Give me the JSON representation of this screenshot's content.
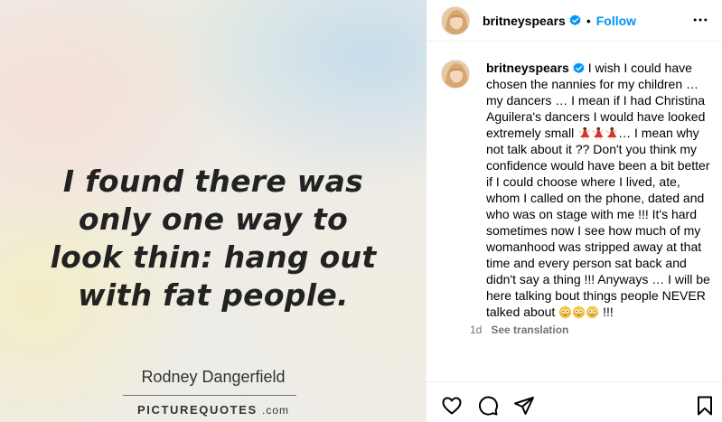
{
  "media": {
    "quote_lines": [
      "I found there was",
      "only one way to",
      "look thin: hang out",
      "with fat people."
    ],
    "author": "Rodney Dangerfield",
    "watermark_main": "PICTUREQUOTES",
    "watermark_suffix": ".com"
  },
  "header": {
    "username": "britneyspears",
    "separator": "•",
    "follow_label": "Follow"
  },
  "caption": {
    "username": "britneyspears",
    "text_part1": "I wish I could have chosen the nannies for my children … my dancers … I mean if I had Christina Aguilera's dancers I would have looked extremely small",
    "text_part2": "… I mean why not talk about it ?? Don't you think my confidence would have been a bit better if I could choose where I lived, ate, whom I called on the phone, dated and who was on stage with me !!! It's hard sometimes now I see how much of my womanhood was stripped away at that time and every person sat back and didn't say a thing !!! Anyways … I will be here talking bout things people NEVER talked about",
    "text_end": "!!!",
    "emojis_dancer": [
      "dancer-emoji",
      "dancer-emoji",
      "dancer-emoji"
    ],
    "emojis_face": [
      "flushed-face-emoji",
      "flushed-face-emoji",
      "flushed-face-emoji"
    ]
  },
  "meta": {
    "time_ago": "1d",
    "see_translation": "See translation"
  },
  "actions": [
    "heart-icon",
    "comment-icon",
    "share-icon",
    "bookmark-icon"
  ],
  "colors": {
    "link_blue": "#0095f6",
    "verified_blue": "#0095f6",
    "muted_text": "#737373",
    "divider": "#efefef"
  }
}
